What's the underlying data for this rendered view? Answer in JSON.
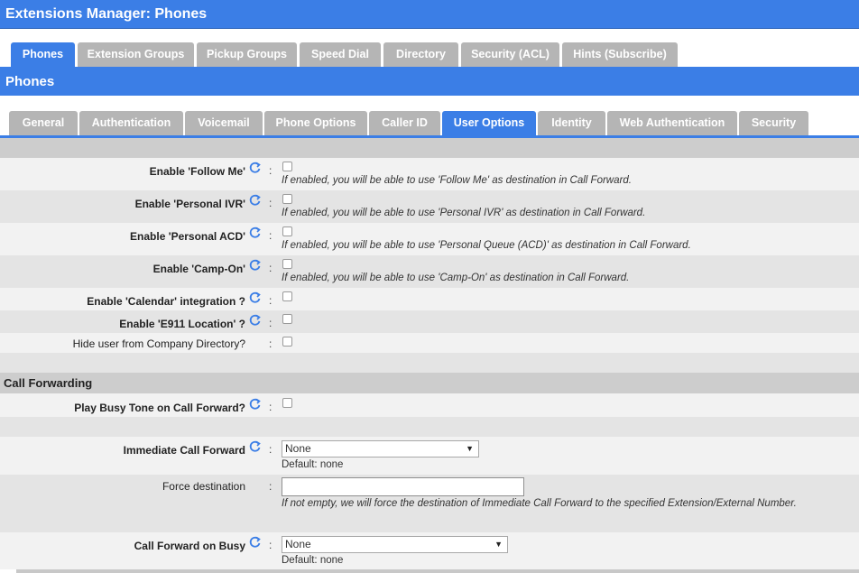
{
  "window": {
    "title": "Extensions Manager:  Phones"
  },
  "main_tabs": [
    {
      "label": "Phones",
      "active": true
    },
    {
      "label": "Extension Groups",
      "active": false
    },
    {
      "label": "Pickup Groups",
      "active": false
    },
    {
      "label": "Speed Dial",
      "active": false
    },
    {
      "label": "Directory",
      "active": false
    },
    {
      "label": "Security (ACL)",
      "active": false
    },
    {
      "label": "Hints (Subscribe)",
      "active": false
    }
  ],
  "section": {
    "title": "Phones"
  },
  "sub_tabs": [
    {
      "label": "General",
      "active": false
    },
    {
      "label": "Authentication",
      "active": false
    },
    {
      "label": "Voicemail",
      "active": false
    },
    {
      "label": "Phone Options",
      "active": false
    },
    {
      "label": "Caller ID",
      "active": false
    },
    {
      "label": "User Options",
      "active": true
    },
    {
      "label": "Identity",
      "active": false
    },
    {
      "label": "Web Authentication",
      "active": false
    },
    {
      "label": "Security",
      "active": false
    }
  ],
  "user_options": {
    "follow_me": {
      "label": "Enable 'Follow Me'",
      "checked": false,
      "hint": "If enabled, you will be able to use 'Follow Me' as destination in Call Forward."
    },
    "personal_ivr": {
      "label": "Enable 'Personal IVR'",
      "checked": false,
      "hint": "If enabled, you will be able to use 'Personal IVR' as destination in Call Forward."
    },
    "personal_acd": {
      "label": "Enable 'Personal ACD'",
      "checked": false,
      "hint": "If enabled, you will be able to use 'Personal Queue (ACD)' as destination in Call Forward."
    },
    "camp_on": {
      "label": "Enable 'Camp-On'",
      "checked": false,
      "hint": "If enabled, you will be able to use 'Camp-On' as destination in Call Forward."
    },
    "calendar": {
      "label": "Enable 'Calendar' integration ?",
      "checked": false
    },
    "e911": {
      "label": "Enable 'E911 Location' ?",
      "checked": false
    },
    "hide_directory": {
      "label": "Hide user from Company Directory?",
      "checked": false
    }
  },
  "call_forwarding": {
    "header": "Call Forwarding",
    "busy_tone": {
      "label": "Play Busy Tone on Call Forward?",
      "checked": false
    },
    "immediate": {
      "label": "Immediate Call Forward",
      "value": "None",
      "default_text": "Default: none"
    },
    "force_destination": {
      "label": "Force destination",
      "value": "",
      "hint": "If not empty, we will force the destination of Immediate Call Forward to the specified Extension/External Number."
    },
    "on_busy": {
      "label": "Call Forward on Busy",
      "value": "None",
      "default_text": "Default: none"
    }
  },
  "colors": {
    "accent": "#3b7ee6",
    "tab_inactive": "#b5b5b5",
    "row_light": "#f2f2f2",
    "row_dark": "#e4e4e4"
  },
  "icons": {
    "help": "refresh-help-icon",
    "dropdown": "chevron-down-icon"
  }
}
